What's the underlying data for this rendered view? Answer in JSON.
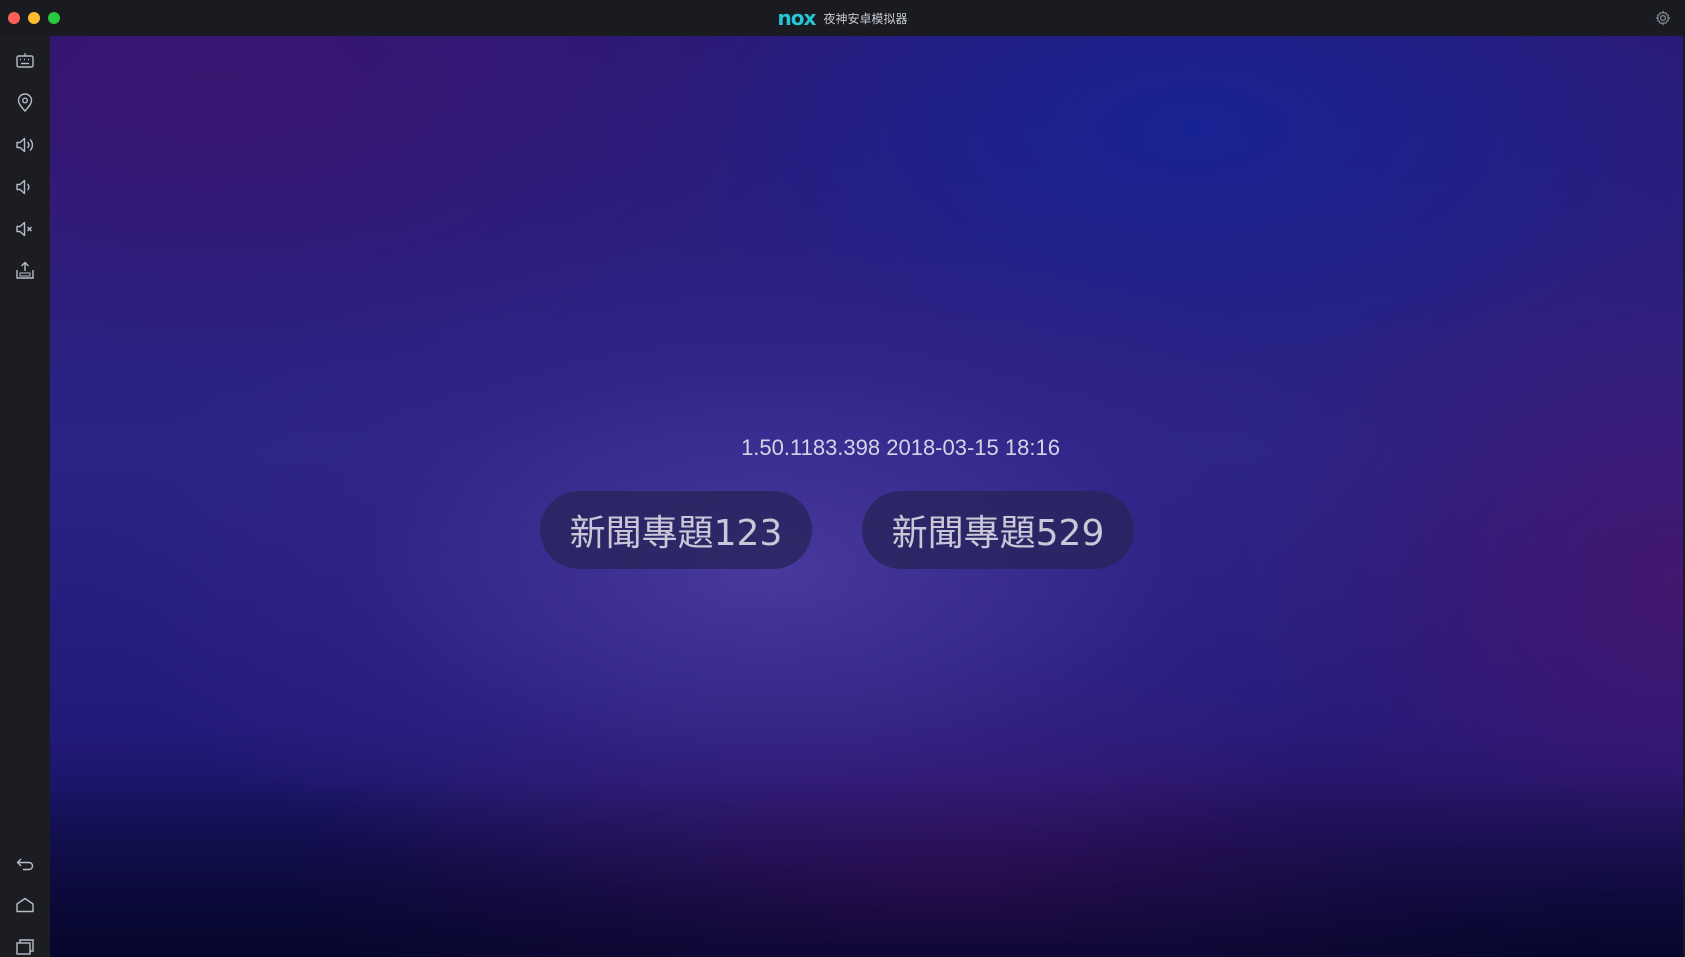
{
  "window": {
    "brand_logo": "nox",
    "title": "夜神安卓模拟器",
    "colors": {
      "accent": "#27c6d6",
      "close": "#fe5f57",
      "minimize": "#febc2e",
      "maximize": "#28c840"
    }
  },
  "sidebar": {
    "top_items": [
      {
        "name": "keyboard-icon"
      },
      {
        "name": "location-icon"
      },
      {
        "name": "volume-up-icon"
      },
      {
        "name": "volume-down-icon"
      },
      {
        "name": "mute-icon"
      },
      {
        "name": "apk-install-icon"
      }
    ],
    "bottom_items": [
      {
        "name": "back-icon"
      },
      {
        "name": "home-icon"
      },
      {
        "name": "recent-apps-icon"
      }
    ]
  },
  "screen": {
    "version_text": "1.50.1183.398 2018-03-15 18:16",
    "buttons": [
      {
        "label": "新聞專題123"
      },
      {
        "label": "新聞專題529"
      }
    ]
  }
}
